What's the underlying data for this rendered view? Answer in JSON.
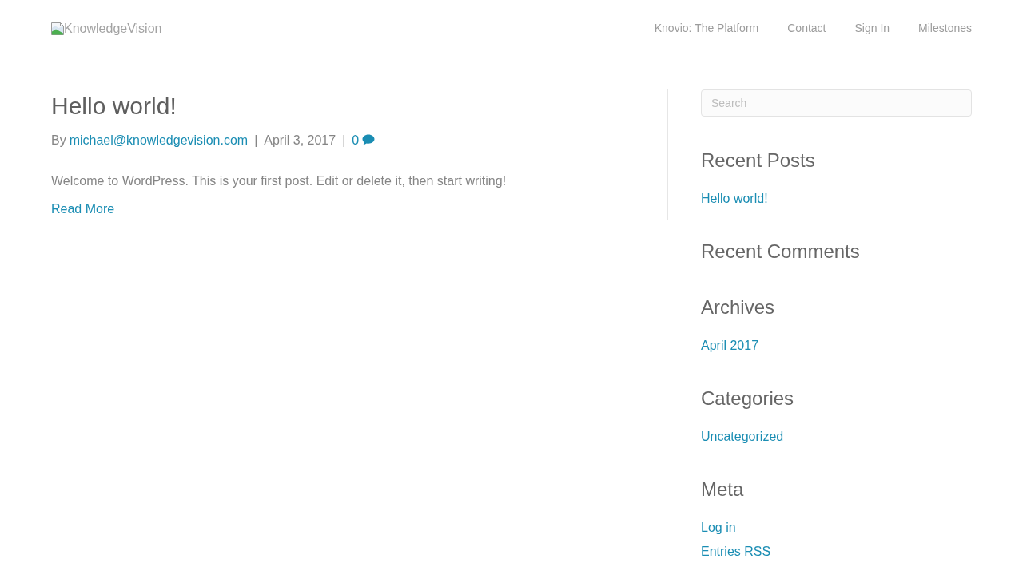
{
  "header": {
    "logo": {
      "alt_text": "KnowledgeVision"
    },
    "nav": [
      {
        "label": "Knovio: The Platform"
      },
      {
        "label": "Contact"
      },
      {
        "label": "Sign In"
      },
      {
        "label": "Milestones"
      }
    ]
  },
  "post": {
    "title": "Hello world!",
    "byline_prefix": "By",
    "author": "michael@knowledgevision.com",
    "separators": [
      "|",
      "|"
    ],
    "date": "April 3, 2017",
    "comment_count": "0",
    "excerpt": "Welcome to WordPress. This is your first post. Edit or delete it, then start writing!",
    "read_more": "Read More"
  },
  "sidebar": {
    "search": {
      "placeholder": "Search"
    },
    "widgets": [
      {
        "title": "Recent Posts",
        "links": [
          "Hello world!"
        ]
      },
      {
        "title": "Recent Comments"
      },
      {
        "title": "Archives",
        "links": [
          "April 2017"
        ]
      },
      {
        "title": "Categories",
        "links": [
          "Uncategorized"
        ]
      },
      {
        "title": "Meta",
        "links": [
          "Log in",
          "Entries RSS"
        ]
      }
    ]
  }
}
